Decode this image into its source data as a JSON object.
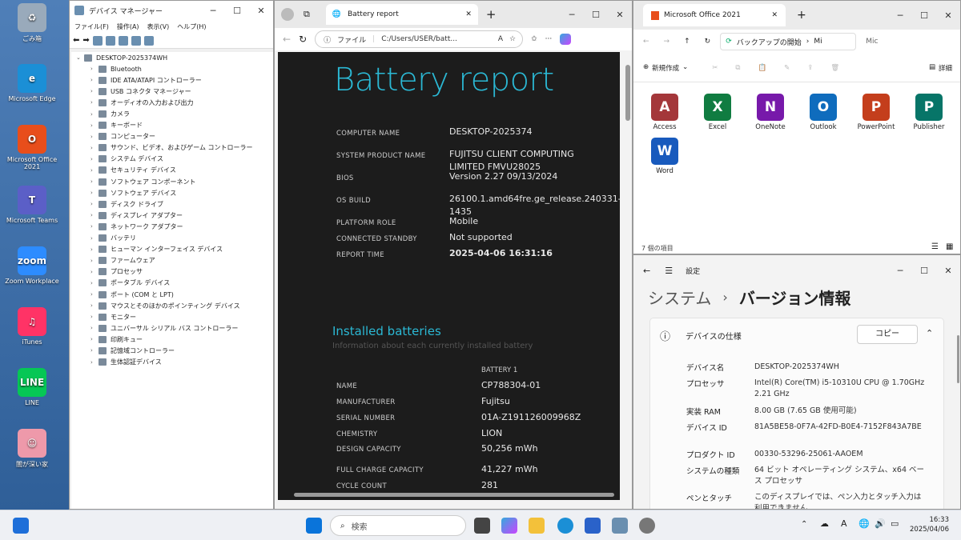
{
  "desktop": {
    "icons": [
      {
        "label": "ごみ箱",
        "name": "recycle-bin-icon",
        "color": "#9ab",
        "glyph": "♻"
      },
      {
        "label": "Microsoft Edge",
        "name": "edge-icon",
        "color": "#1b8fd6",
        "glyph": "e"
      },
      {
        "label": "Microsoft Office 2021",
        "name": "office-icon",
        "color": "#e84e1b",
        "glyph": "O"
      },
      {
        "label": "Microsoft Teams",
        "name": "teams-icon",
        "color": "#5b5fc7",
        "glyph": "T"
      },
      {
        "label": "Zoom Workplace",
        "name": "zoom-icon",
        "color": "#2d8cff",
        "glyph": "zoom"
      },
      {
        "label": "iTunes",
        "name": "itunes-icon",
        "color": "#f36",
        "glyph": "♫"
      },
      {
        "label": "LINE",
        "name": "line-icon",
        "color": "#06c755",
        "glyph": "LINE"
      },
      {
        "label": "闇が深い家",
        "name": "shortcut-icon",
        "color": "#e9a",
        "glyph": "☺"
      }
    ]
  },
  "devmgr": {
    "title": "デバイス マネージャー",
    "menu": [
      "ファイル(F)",
      "操作(A)",
      "表示(V)",
      "ヘルプ(H)"
    ],
    "root": "DESKTOP-2025374WH",
    "items": [
      "Bluetooth",
      "IDE ATA/ATAPI コントローラー",
      "USB コネクタ マネージャー",
      "オーディオの入力および出力",
      "カメラ",
      "キーボード",
      "コンピューター",
      "サウンド、ビデオ、およびゲーム コントローラー",
      "システム デバイス",
      "セキュリティ デバイス",
      "ソフトウェア コンポーネント",
      "ソフトウェア デバイス",
      "ディスク ドライブ",
      "ディスプレイ アダプター",
      "ネットワーク アダプター",
      "バッテリ",
      "ヒューマン インターフェイス デバイス",
      "ファームウェア",
      "プロセッサ",
      "ポータブル デバイス",
      "ポート (COM と LPT)",
      "マウスとそのほかのポインティング デバイス",
      "モニター",
      "ユニバーサル シリアル バス コントローラー",
      "印刷キュー",
      "記憶域コントローラー",
      "生体認証デバイス"
    ]
  },
  "edge": {
    "tab_title": "Battery report",
    "url_prefix": "ファイル",
    "url": "C:/Users/USER/batt...",
    "report": {
      "title": "Battery report",
      "rows": [
        {
          "k": "COMPUTER NAME",
          "v": "DESKTOP-2025374"
        },
        {
          "k": "SYSTEM PRODUCT NAME",
          "v": "FUJITSU CLIENT COMPUTING LIMITED FMVU28025"
        },
        {
          "k": "BIOS",
          "v": "Version 2.27 09/13/2024"
        },
        {
          "k": "OS BUILD",
          "v": "26100.1.amd64fre.ge_release.240331-1435"
        },
        {
          "k": "PLATFORM ROLE",
          "v": "Mobile"
        },
        {
          "k": "CONNECTED STANDBY",
          "v": "Not supported"
        },
        {
          "k": "REPORT TIME",
          "v": "2025-04-06   16:31:16"
        }
      ],
      "installed_title": "Installed batteries",
      "installed_sub": "Information about each currently installed battery",
      "battery_header": "BATTERY 1",
      "battery_rows": [
        {
          "k": "NAME",
          "v": "CP788304-01"
        },
        {
          "k": "MANUFACTURER",
          "v": "Fujitsu"
        },
        {
          "k": "SERIAL NUMBER",
          "v": "01A-Z191126009968Z"
        },
        {
          "k": "CHEMISTRY",
          "v": "LION"
        },
        {
          "k": "DESIGN CAPACITY",
          "v": "50,256 mWh"
        },
        {
          "k": "FULL CHARGE CAPACITY",
          "v": "41,227 mWh"
        },
        {
          "k": "CYCLE COUNT",
          "v": "281"
        }
      ]
    }
  },
  "explorer": {
    "tab_title": "Microsoft Office 2021",
    "breadcrumb": "バックアップの開始",
    "crumb2": "Mi",
    "search": "Mic",
    "new_label": "新規作成",
    "details_label": "詳細",
    "status": "7 個の項目",
    "apps": [
      {
        "label": "Access",
        "color": "#a4373a",
        "glyph": "A"
      },
      {
        "label": "Excel",
        "color": "#107c41",
        "glyph": "X"
      },
      {
        "label": "OneNote",
        "color": "#7719aa",
        "glyph": "N"
      },
      {
        "label": "Outlook",
        "color": "#0f6cbd",
        "glyph": "O"
      },
      {
        "label": "PowerPoint",
        "color": "#c43e1c",
        "glyph": "P"
      },
      {
        "label": "Publisher",
        "color": "#077568",
        "glyph": "P"
      },
      {
        "label": "Word",
        "color": "#185abd",
        "glyph": "W"
      }
    ]
  },
  "settings": {
    "app": "設定",
    "crumb1": "システム",
    "crumb2": "バージョン情報",
    "section": "デバイスの仕様",
    "copy": "コピー",
    "specs": [
      {
        "k": "デバイス名",
        "v": "DESKTOP-2025374WH"
      },
      {
        "k": "プロセッサ",
        "v": "Intel(R) Core(TM) i5-10310U CPU @ 1.70GHz   2.21 GHz"
      },
      {
        "k": "実装 RAM",
        "v": "8.00 GB (7.65 GB 使用可能)"
      },
      {
        "k": "デバイス ID",
        "v": "81A5BE58-0F7A-42FD-B0E4-7152F843A7BE"
      },
      {
        "k": "プロダクト ID",
        "v": "00330-53296-25061-AAOEM"
      },
      {
        "k": "システムの種類",
        "v": "64 ビット オペレーティング システム、x64 ベース プロセッサ"
      },
      {
        "k": "ペンとタッチ",
        "v": "このディスプレイでは、ペン入力とタッチ入力は利用できません"
      }
    ]
  },
  "taskbar": {
    "search": "検索",
    "time": "16:33",
    "date": "2025/04/06"
  }
}
